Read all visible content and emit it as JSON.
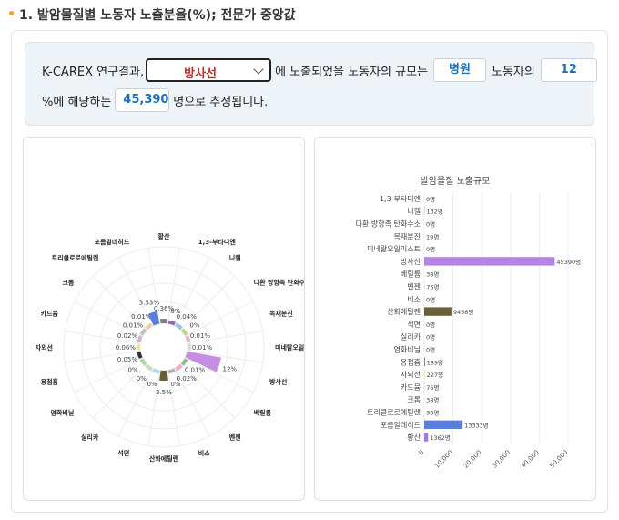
{
  "header": {
    "title": "1. 발암물질별 노동자 노출분율(%); 전문가 중앙값"
  },
  "query": {
    "prefix": "K-CAREX 연구결과,",
    "selected_agent": "방사선",
    "mid_text": "에 노출되었을 노동자의 규모는",
    "industry": "병원",
    "after_industry": "노동자의",
    "percent_value": "12",
    "line2_prefix": "%에 해당하는",
    "worker_count": "45,390",
    "suffix": "명으로 추정됩니다."
  },
  "colors": {
    "accent_red": "#c0282d",
    "accent_blue": "#1e6fb4",
    "dot_orange": "#f0a030"
  },
  "chart_data": [
    {
      "type": "polar-bar",
      "categories": [
        "황산",
        "1,3-부타디엔",
        "니켈",
        "다환 방향족 탄화수소",
        "목재분진",
        "미네랄오일미스트",
        "방사선",
        "베릴륨",
        "벤젠",
        "비소",
        "산화에틸렌",
        "석면",
        "실리카",
        "염화비닐",
        "용접흄",
        "자외선",
        "카드뮴",
        "크롬",
        "트리클로로에틸렌",
        "포름알데히드"
      ],
      "values": [
        0.36,
        0,
        0.04,
        0,
        0.01,
        0.01,
        12,
        0.01,
        0.02,
        0,
        2.5,
        0,
        0,
        0,
        0.05,
        0.06,
        0.02,
        0.01,
        0.01,
        3.53
      ],
      "value_labels": [
        "0.36%",
        "0%",
        "0.04%",
        "0%",
        "0.01%",
        "0.01%",
        "12%",
        "0.01%",
        "0.02%",
        "0%",
        "2.5%",
        "0%",
        "0%",
        "0%",
        "0.05%",
        "0.06%",
        "0.02%",
        "0.01%",
        "0.01%",
        "3.53%"
      ],
      "colors": [
        "#7f7f7f",
        "#9467bd",
        "#8ec5e8",
        "#b7d986",
        "#e8b8d0",
        "#d9d9d9",
        "#c58ee3",
        "#8fbc8f",
        "#f4a8b8",
        "#b0b0b0",
        "#6b5f3a",
        "#b1d7f0",
        "#c7e0b8",
        "#a1d99b",
        "#333333",
        "#e8e5a0",
        "#d8b0d8",
        "#c0c0c0",
        "#f5c9a0",
        "#5b7fd9"
      ]
    },
    {
      "type": "bar",
      "orientation": "horizontal",
      "title": "발암물질 노출규모",
      "categories": [
        "1,3-부타디엔",
        "니켈",
        "다환 방향족 탄화수소",
        "목재분진",
        "미네랄오일미스트",
        "방사선",
        "베릴륨",
        "벤젠",
        "비소",
        "산화에틸렌",
        "석면",
        "실리카",
        "염화비닐",
        "용접흄",
        "자외선",
        "카드뮴",
        "크롬",
        "트리클로로에틸렌",
        "포름알데히드",
        "황산"
      ],
      "values": [
        0,
        132,
        0,
        19,
        0,
        45390,
        38,
        76,
        0,
        9456,
        0,
        0,
        0,
        189,
        227,
        76,
        38,
        38,
        13333,
        1362
      ],
      "value_labels": [
        "0명",
        "132명",
        "0명",
        "19명",
        "0명",
        "45390명",
        "38명",
        "76명",
        "0명",
        "9456명",
        "0명",
        "0명",
        "0명",
        "189명",
        "227명",
        "76명",
        "38명",
        "38명",
        "13333명",
        "1362명"
      ],
      "colors": [
        "#9467bd",
        "#8ec5e8",
        "#b7d986",
        "#e8b8d0",
        "#d9d9d9",
        "#b784e6",
        "#8fbc8f",
        "#f4a8b8",
        "#b0b0b0",
        "#6b5f3a",
        "#b1d7f0",
        "#c7e0b8",
        "#a1d99b",
        "#333333",
        "#e8e5a0",
        "#d8b0d8",
        "#c0c0c0",
        "#f5c9a0",
        "#5b7fd9",
        "#a47ae0"
      ],
      "xlim": [
        0,
        50000
      ],
      "xticks": [
        "0",
        "10,000",
        "20,000",
        "30,000",
        "40,000",
        "50,000"
      ],
      "grid": true
    }
  ]
}
